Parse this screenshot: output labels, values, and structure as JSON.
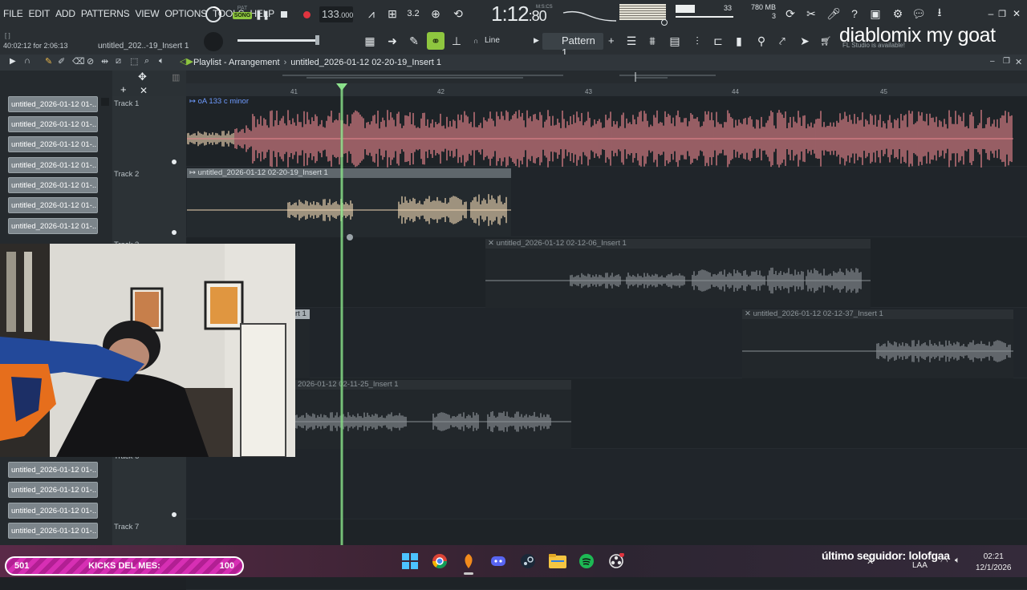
{
  "menu": [
    "FILE",
    "EDIT",
    "ADD",
    "PATTERNS",
    "VIEW",
    "OPTIONS",
    "TOOLS",
    "HELP"
  ],
  "pat_song": {
    "pat": "PAT",
    "song": "SONG"
  },
  "tempo": {
    "value": "133",
    "decimals": ".000"
  },
  "time": {
    "minutes": "1:12",
    "cs": ":80",
    "unit": "M:S:CS"
  },
  "cpu": {
    "voices": "33",
    "memory": "780 MB",
    "count": "3"
  },
  "hint_left": "40:02:12 for 2:06:13",
  "hint_file": "untitled_202..-19_Insert 1",
  "snap_label": "Line",
  "pattern_name": "Pattern 1",
  "overlay_title": "diablomix my goat",
  "fl_available": "FL Studio is available!",
  "playlist": {
    "title": "Playlist - Arrangement",
    "file": "untitled_2026-01-12 02-20-19_Insert 1"
  },
  "timeline_bars": [
    "41",
    "42",
    "43",
    "44",
    "45"
  ],
  "clip_list": [
    "untitled_2026-01-12 01-...",
    "untitled_2026-01-12 01-...",
    "untitled_2026-01-12 01-...",
    "untitled_2026-01-12 01-...",
    "untitled_2026-01-12 01-...",
    "untitled_2026-01-12 01-...",
    "untitled_2026-01-12 01-...",
    "untitled_2026-01-12 01-...",
    "untitled_2026-01-12 01-...",
    "untitled_2026-01-12 01-...",
    "untitled_2026-01-12 01-..."
  ],
  "tracks": {
    "t1": "Track 1",
    "t2": "Track 2",
    "t3": "Track 3",
    "t6": "Track 6",
    "t7": "Track 7"
  },
  "clips": {
    "track1": "oA 133 c minor",
    "track2": "untitled_2026-01-12 02-20-19_Insert 1",
    "track3": "untitled_2026-01-12 02-12-06_Insert 1",
    "track4a": "rt 1",
    "track4b": "untitled_2026-01-12 02-12-37_Insert 1",
    "track5": "2026-01-12 02-11-25_Insert 1"
  },
  "taskbar": {
    "kicks_count": "501",
    "kicks_label": "KICKS DEL MES:",
    "kicks_goal": "100",
    "follower": "último seguidor: lolofgaa",
    "lang": "LAA",
    "time": "02:21",
    "date": "12/1/2026"
  },
  "colors": {
    "accent_green": "#8ec63f",
    "track1_wave": "#e8868e",
    "track2_wave": "#f1d7b4",
    "muted_wave": "#8b9196",
    "record": "#e0343f",
    "kicks_bg": "#d72fb4"
  }
}
